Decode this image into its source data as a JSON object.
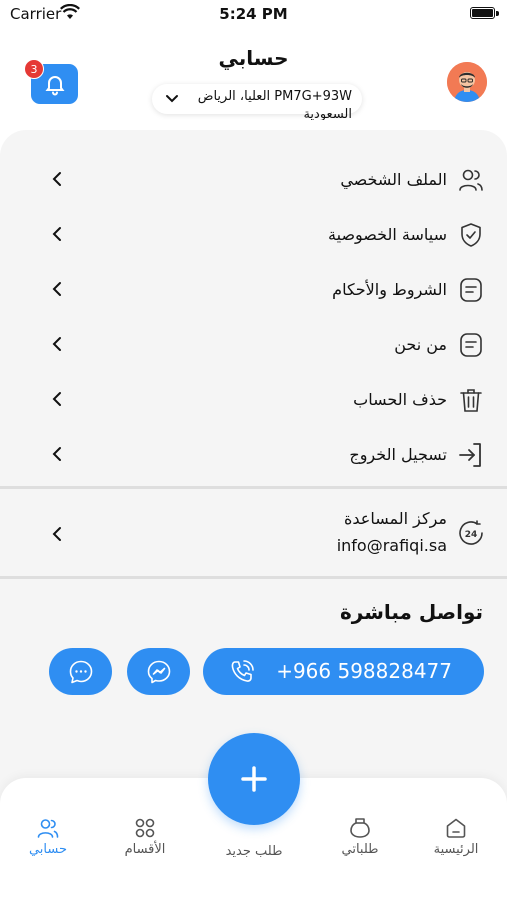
{
  "status_bar": {
    "carrier": "Carrier",
    "time": "5:24 PM"
  },
  "header": {
    "title": "حسابي",
    "notification_count": "3",
    "location": "PM7G+93W العليا، الرياض السعودية"
  },
  "menu": {
    "items": [
      {
        "label": "الملف الشخصي",
        "icon": "profile-icon"
      },
      {
        "label": "سياسة الخصوصية",
        "icon": "shield-icon"
      },
      {
        "label": "الشروط والأحكام",
        "icon": "document-icon"
      },
      {
        "label": "من نحن",
        "icon": "info-document-icon"
      },
      {
        "label": "حذف الحساب",
        "icon": "trash-icon"
      },
      {
        "label": "تسجيل الخروج",
        "icon": "logout-icon"
      }
    ]
  },
  "help": {
    "title": "مركز المساعدة",
    "email": "info@rafiqi.sa"
  },
  "contact": {
    "title": "تواصل مباشرة",
    "phone": "+966 598828477"
  },
  "bottom_nav": {
    "home": "الرئيسية",
    "orders": "طلباتي",
    "new_order": "طلب جديد",
    "categories": "الأقسام",
    "account": "حسابي"
  },
  "colors": {
    "accent": "#2f8ef2",
    "badge": "#e53935"
  }
}
